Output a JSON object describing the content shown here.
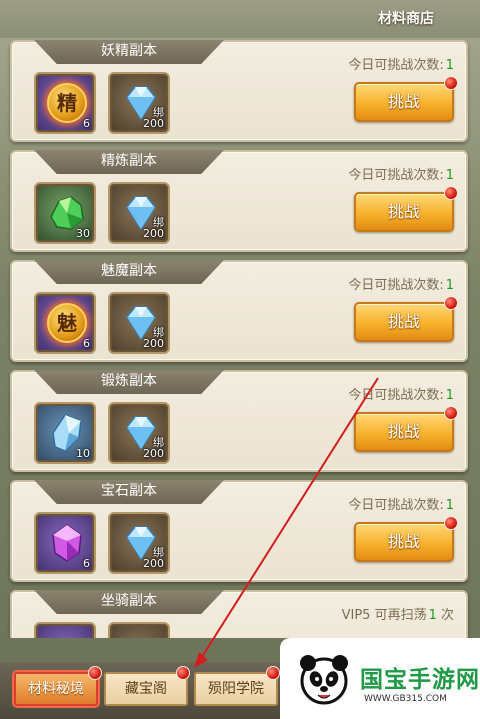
{
  "header": {
    "shop_label": "材料商店"
  },
  "dungeons": [
    {
      "title": "妖精副本",
      "item1": {
        "glyph": "精",
        "qty": "6"
      },
      "item2": {
        "bind": "绑",
        "qty": "200"
      },
      "limit_label": "今日可挑战次数:",
      "limit_value": "1",
      "button": "挑战"
    },
    {
      "title": "精炼副本",
      "item1": {
        "qty": "30"
      },
      "item2": {
        "bind": "绑",
        "qty": "200"
      },
      "limit_label": "今日可挑战次数:",
      "limit_value": "1",
      "button": "挑战"
    },
    {
      "title": "魅魔副本",
      "item1": {
        "glyph": "魅",
        "qty": "6"
      },
      "item2": {
        "bind": "绑",
        "qty": "200"
      },
      "limit_label": "今日可挑战次数:",
      "limit_value": "1",
      "button": "挑战"
    },
    {
      "title": "锻炼副本",
      "item1": {
        "qty": "10"
      },
      "item2": {
        "bind": "绑",
        "qty": "200"
      },
      "limit_label": "今日可挑战次数:",
      "limit_value": "1",
      "button": "挑战"
    },
    {
      "title": "宝石副本",
      "item1": {
        "qty": "6"
      },
      "item2": {
        "bind": "绑",
        "qty": "200"
      },
      "limit_label": "今日可挑战次数:",
      "limit_value": "1",
      "button": "挑战"
    },
    {
      "title": "坐骑副本",
      "limit_prefix": "VIP5 可再扫荡",
      "limit_value": "1",
      "limit_suffix": " 次"
    }
  ],
  "tabs": [
    {
      "label": "材料秘境",
      "active": true
    },
    {
      "label": "藏宝阁",
      "active": false
    },
    {
      "label": "殒阳学院",
      "active": false
    }
  ],
  "watermark": {
    "title": "国宝手游网",
    "url": "WWW.GB315.COM"
  },
  "colors": {
    "accent_orange": "#f7b12c",
    "count_green": "#1e9a1e",
    "alert_red": "#d61d12",
    "watermark_green": "#1f9a46"
  }
}
